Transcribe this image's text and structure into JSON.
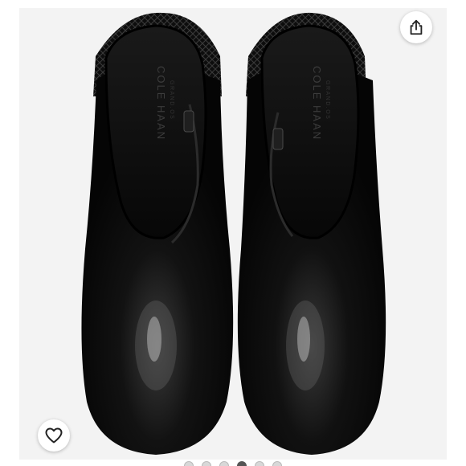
{
  "listing_photo": {
    "brand_text": "COLE HAAN",
    "brand_subtext": "GRAND.OS",
    "colors": {
      "leather": "#0b0b0b",
      "background": "#f3f3f3",
      "highlight": "#8a8a8a"
    }
  },
  "actions": {
    "share_icon": "share-icon",
    "like_icon": "heart-outline-icon"
  },
  "carousel": {
    "total_images": 6,
    "active_index": 3
  }
}
